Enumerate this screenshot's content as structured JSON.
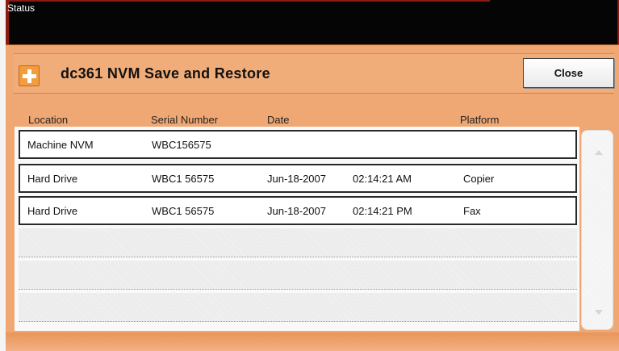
{
  "status_bar": {
    "label": "Status"
  },
  "header": {
    "icon": "add-plus-icon",
    "title": "dc361 NVM Save and Restore",
    "close_label": "Close"
  },
  "table": {
    "columns": [
      "Location",
      "Serial Number",
      "Date",
      "Platform"
    ],
    "rows": [
      {
        "location": "Machine NVM",
        "serial": "WBC156575",
        "date": "",
        "time": "",
        "platform": ""
      },
      {
        "location": "Hard Drive",
        "serial": "WBC1 56575",
        "date": "Jun-18-2007",
        "time": "02:14:21 AM",
        "platform": "Copier"
      },
      {
        "location": "Hard Drive",
        "serial": "WBC1 56575",
        "date": "Jun-18-2007",
        "time": "02:14:21 PM",
        "platform": "Fax"
      }
    ]
  },
  "scrollbar": {
    "up_icon": "scroll-up-arrow-icon",
    "down_icon": "scroll-down-arrow-icon"
  },
  "colors": {
    "panel": "#efa873",
    "header": "#f1ad79",
    "status_bar": "#050505",
    "icon": "#f29c3d"
  }
}
